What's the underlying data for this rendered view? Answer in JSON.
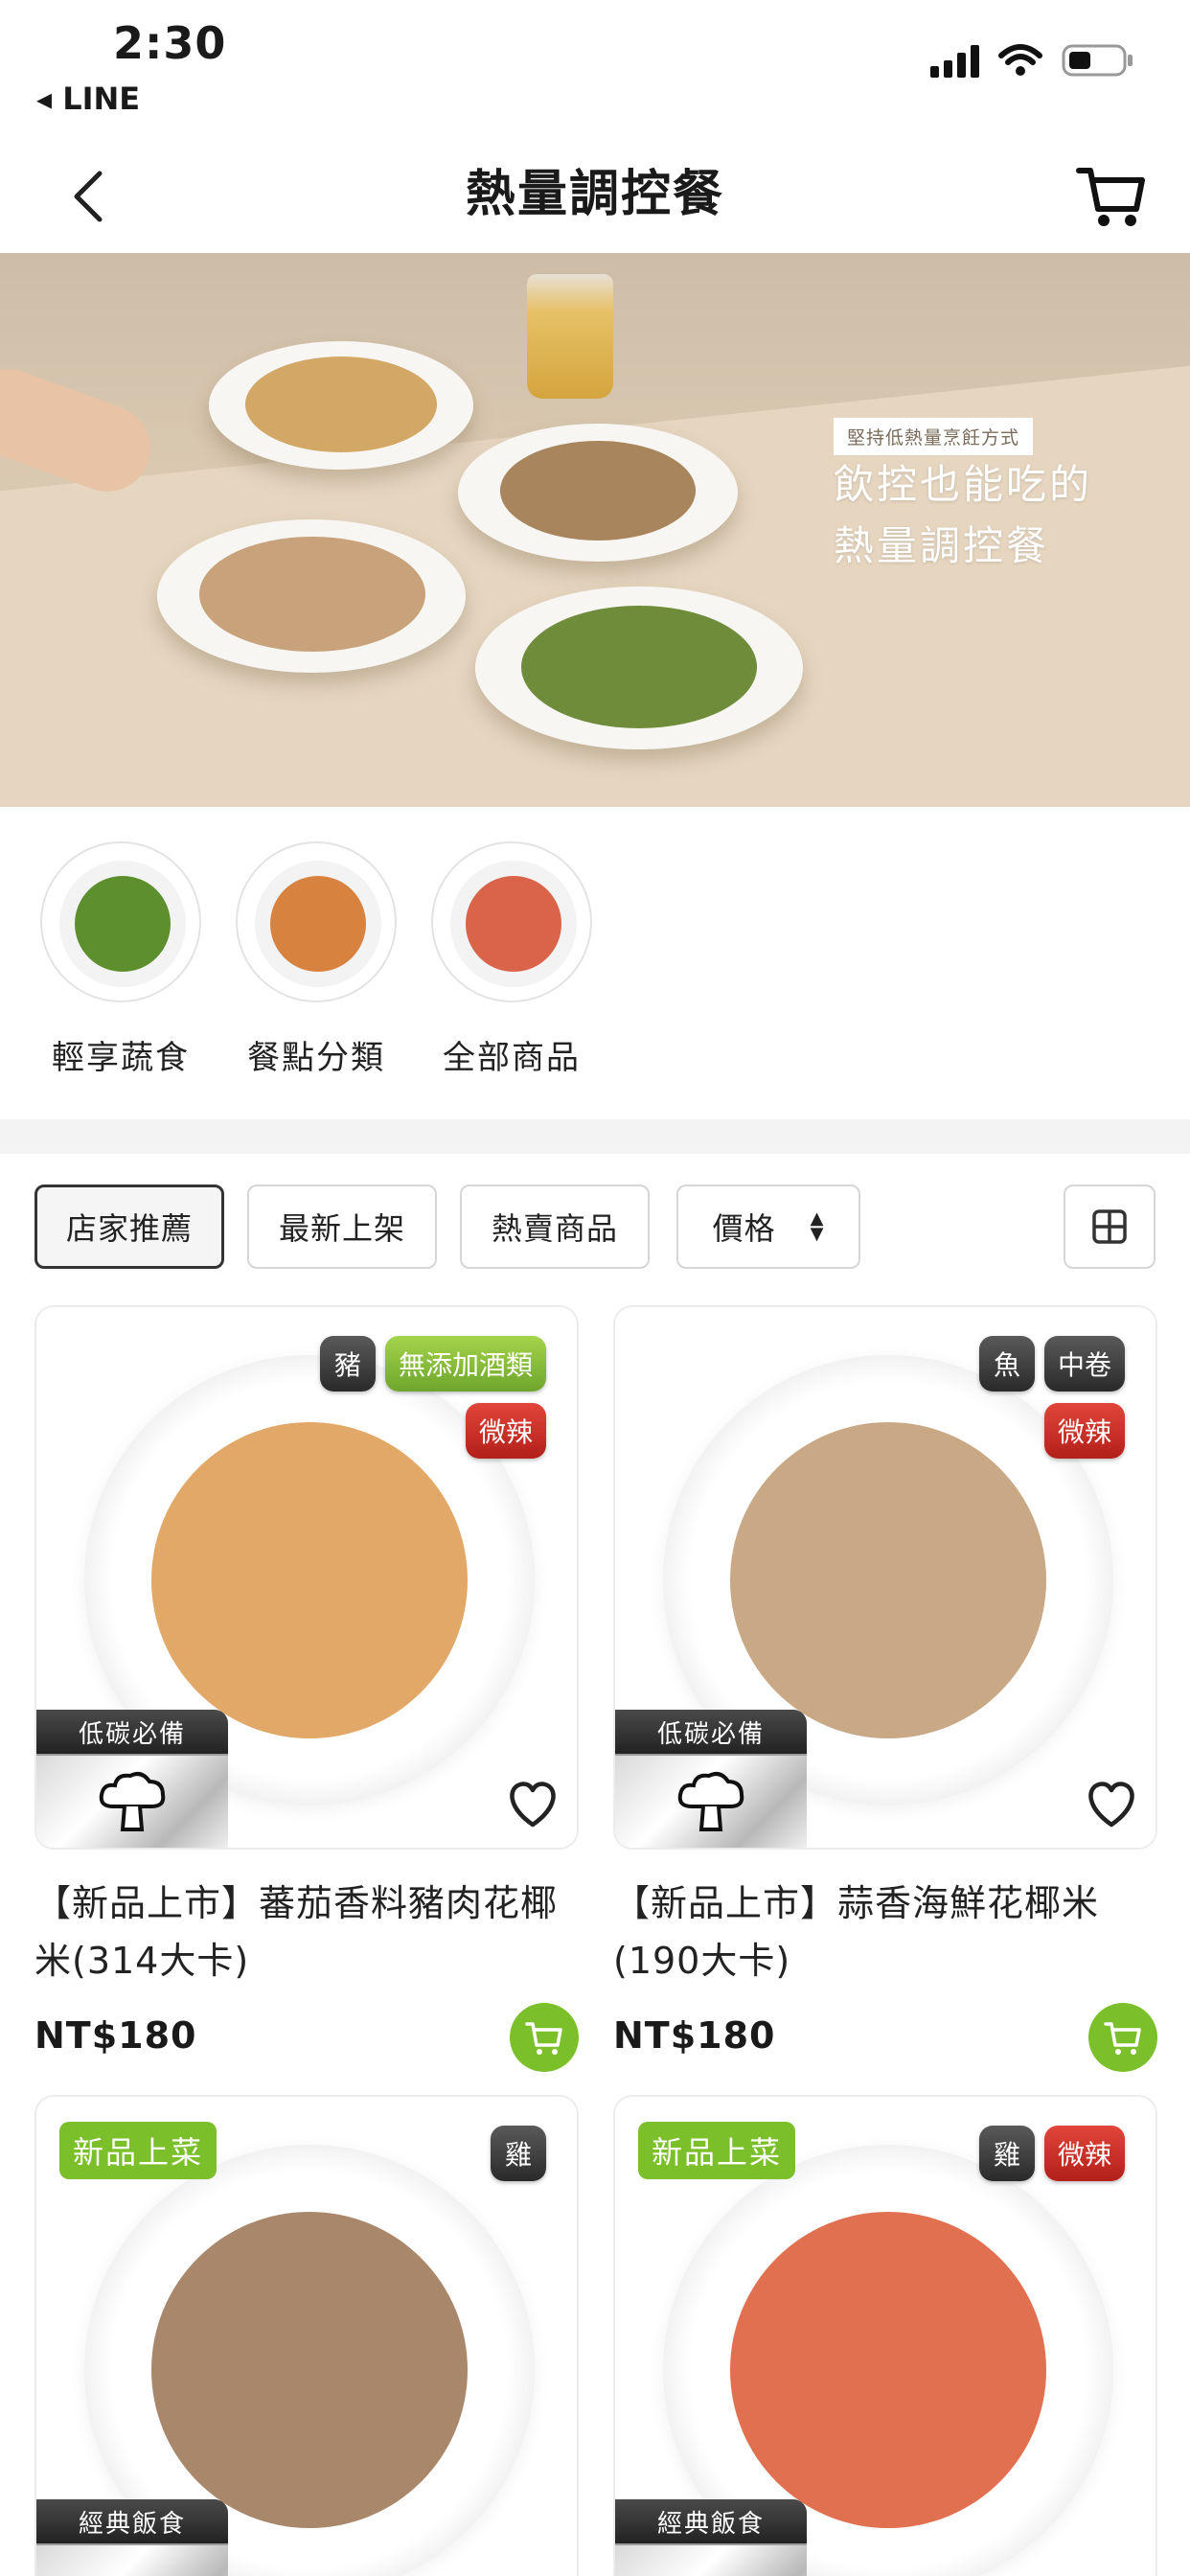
{
  "status_bar": {
    "time": "2:30",
    "back_app": "◂ LINE"
  },
  "nav": {
    "title": "熱量調控餐"
  },
  "hero": {
    "tag": "堅持低熱量烹飪方式",
    "headline_line1": "飲控也能吃的",
    "headline_line2": "熱量調控餐"
  },
  "categories": [
    {
      "label": "輕享蔬食",
      "food_color": "#5e8f2e"
    },
    {
      "label": "餐點分類",
      "food_color": "#d7823f"
    },
    {
      "label": "全部商品",
      "food_color": "#d9644a"
    }
  ],
  "filters": {
    "recommended": "店家推薦",
    "newest": "最新上架",
    "bestseller": "熱賣商品",
    "price": "價格"
  },
  "products": [
    {
      "tags_top": [
        "豬",
        "無添加酒類"
      ],
      "tag_spicy": "微辣",
      "type_label": "低碳必備",
      "name": "【新品上市】蕃茄香料豬肉花椰米(314大卡)",
      "price": "NT$180",
      "food_color": "#e2a867"
    },
    {
      "tags_top": [
        "魚",
        "中卷"
      ],
      "tag_spicy": "微辣",
      "type_label": "低碳必備",
      "name": "【新品上市】蒜香海鮮花椰米(190大卡)",
      "price": "NT$180",
      "food_color": "#c9a886"
    },
    {
      "new_badge": "新品上菜",
      "tags_top": [
        "雞"
      ],
      "type_label": "經典飯食",
      "food_color": "#a8876a"
    },
    {
      "new_badge": "新品上菜",
      "tags_top": [
        "雞",
        "微辣"
      ],
      "type_label": "經典飯食",
      "food_color": "#e0704f"
    }
  ],
  "colors": {
    "accent_green": "#7bbf2a",
    "spicy_red": "#c9271f",
    "tag_dark": "#333333"
  }
}
